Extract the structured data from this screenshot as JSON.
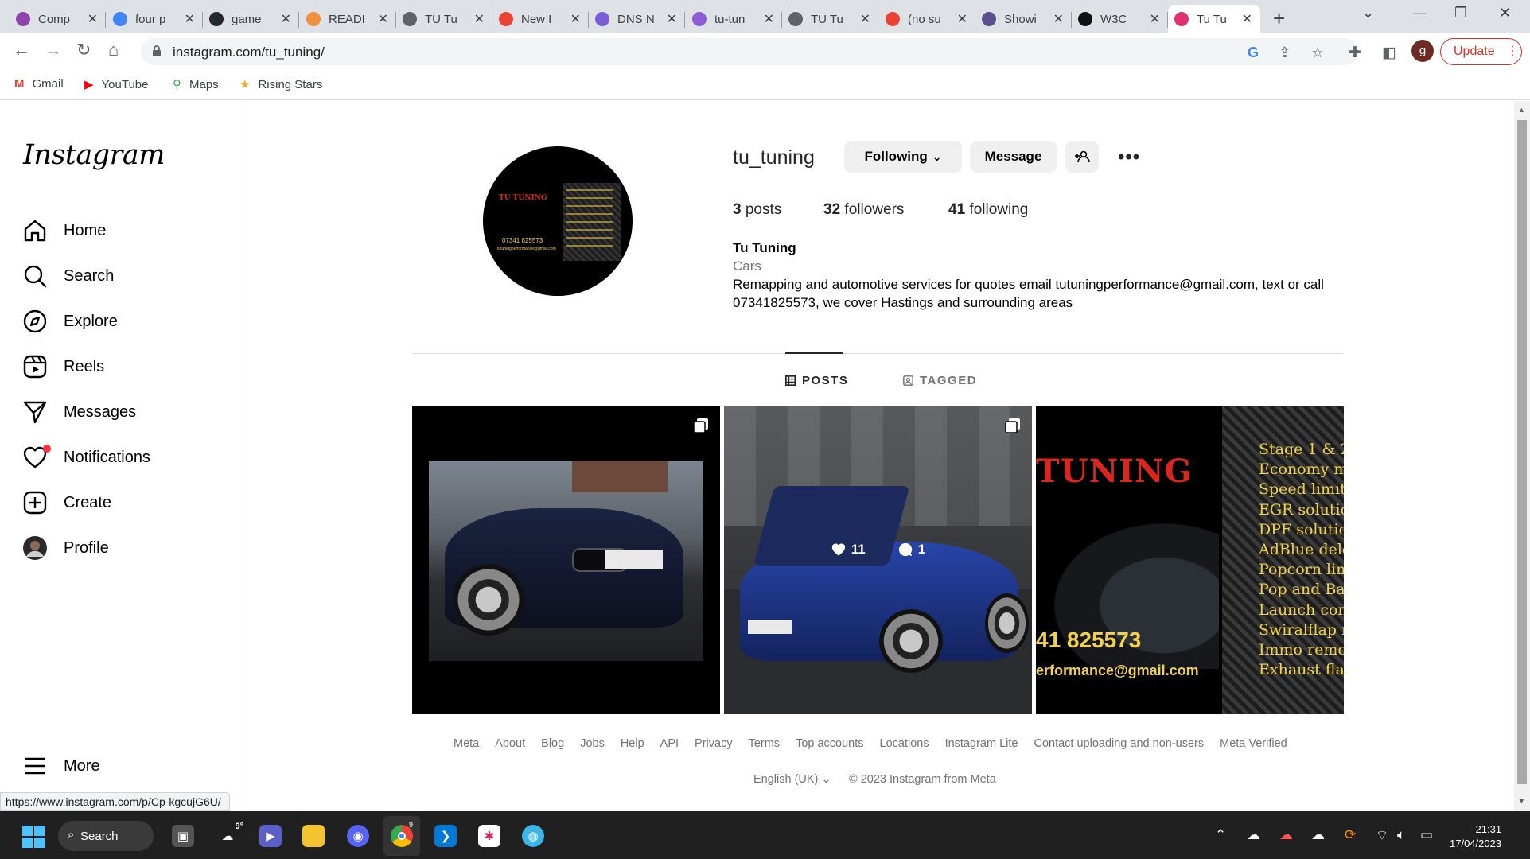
{
  "browser": {
    "tabs": [
      {
        "title": "Comp",
        "favicon": "purple-circle-icon",
        "color": "#8e44ad"
      },
      {
        "title": "four p",
        "favicon": "google-icon",
        "color": "#4285f4"
      },
      {
        "title": "game",
        "favicon": "github-icon",
        "color": "#24292e"
      },
      {
        "title": "READI",
        "favicon": "grammarly-icon",
        "color": "#f0903c"
      },
      {
        "title": "TU Tu",
        "favicon": "globe-icon",
        "color": "#5f6368"
      },
      {
        "title": "New I",
        "favicon": "gmail-icon",
        "color": "#ea4335"
      },
      {
        "title": "DNS N",
        "favicon": "dots-icon",
        "color": "#7b5cd6"
      },
      {
        "title": "tu-tun",
        "favicon": "h-icon",
        "color": "#8e5ad6"
      },
      {
        "title": "TU Tu",
        "favicon": "globe-icon",
        "color": "#5f6368"
      },
      {
        "title": "(no su",
        "favicon": "gmail-icon",
        "color": "#ea4335"
      },
      {
        "title": "Showi",
        "favicon": "owl-icon",
        "color": "#5a4e8c"
      },
      {
        "title": "W3C",
        "favicon": "w3c-icon",
        "color": "#111111"
      },
      {
        "title": "Tu Tu",
        "favicon": "instagram-icon",
        "color": "#e1306c"
      }
    ],
    "url": "instagram.com/tu_tuning/",
    "profile_initial": "g",
    "update_label": "Update",
    "bookmarks": [
      {
        "label": "Gmail",
        "icon": "gmail-icon",
        "color": "#ea4335"
      },
      {
        "label": "YouTube",
        "icon": "youtube-icon",
        "color": "#ff0000"
      },
      {
        "label": "Maps",
        "icon": "maps-icon",
        "color": "#34a853"
      },
      {
        "label": "Rising Stars",
        "icon": "star-icon",
        "color": "#f5a623"
      }
    ],
    "status_url": "https://www.instagram.com/p/Cp-kgcujG6U/"
  },
  "sidebar": {
    "logo": "Instagram",
    "items": [
      {
        "label": "Home",
        "icon": "home-icon"
      },
      {
        "label": "Search",
        "icon": "search-icon"
      },
      {
        "label": "Explore",
        "icon": "compass-icon"
      },
      {
        "label": "Reels",
        "icon": "reels-icon"
      },
      {
        "label": "Messages",
        "icon": "send-icon"
      },
      {
        "label": "Notifications",
        "icon": "heart-icon"
      },
      {
        "label": "Create",
        "icon": "plus-square-icon"
      },
      {
        "label": "Profile",
        "icon": "avatar"
      }
    ],
    "more_label": "More"
  },
  "profile": {
    "username": "tu_tuning",
    "following_btn": "Following",
    "message_btn": "Message",
    "posts_count": "3",
    "posts_label": "posts",
    "followers_count": "32",
    "followers_label": "followers",
    "following_count": "41",
    "following_label": "following",
    "full_name": "Tu Tuning",
    "category": "Cars",
    "bio": "Remapping and automotive services for quotes email tutuningperformance@gmail.com, text or call 07341825573, we cover Hastings and surrounding areas",
    "pic": {
      "brand": "TU TUNING",
      "phone": "07341 825573",
      "email": "tutuningperformance@gmail.com"
    }
  },
  "tabs": {
    "posts": "POSTS",
    "tagged": "TAGGED"
  },
  "posts": {
    "hover_likes": "11",
    "hover_comments": "1",
    "p3_brand": "TUNING",
    "p3_phone": "41 825573",
    "p3_email": "erformance@gmail.com",
    "p3_services": [
      "Stage 1 & 2",
      "Economy m",
      "Speed limit",
      "EGR solutio",
      "DPF solutio",
      "AdBlue dele",
      "Popcorn lim",
      "Pop and Ba",
      "Launch con",
      "Swiralflap r",
      "Immo remo",
      "Exhaust fla"
    ]
  },
  "footer": {
    "links": [
      "Meta",
      "About",
      "Blog",
      "Jobs",
      "Help",
      "API",
      "Privacy",
      "Terms",
      "Top accounts",
      "Locations",
      "Instagram Lite",
      "Contact uploading and non-users",
      "Meta Verified"
    ],
    "language": "English (UK)",
    "copyright": "© 2023 Instagram from Meta"
  },
  "taskbar": {
    "search_label": "Search",
    "weather": "9°",
    "chrome_badge": "9",
    "time": "21:31",
    "date": "17/04/2023"
  }
}
